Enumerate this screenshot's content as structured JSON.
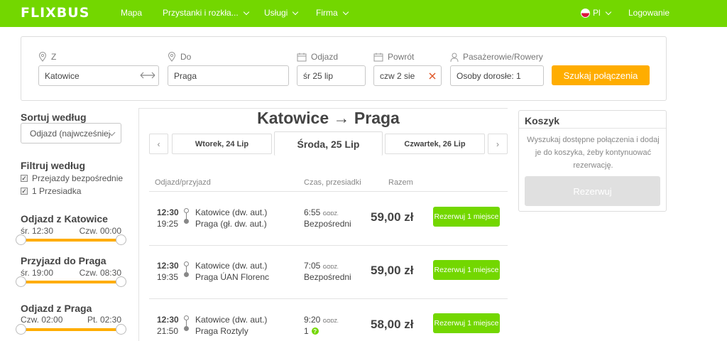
{
  "header": {
    "logo": "FLIXBUS",
    "nav": [
      "Mapa",
      "Przystanki i rozkła...",
      "Usługi",
      "Firma"
    ],
    "lang": "Pl",
    "login": "Logowanie",
    "accent": "#73d700"
  },
  "search": {
    "from_label": "Z",
    "from_value": "Katowice",
    "to_label": "Do",
    "to_value": "Praga",
    "depart_label": "Odjazd",
    "depart_value": "śr 25 lip",
    "return_label": "Powrót",
    "return_value": "czw 2 sie",
    "pax_label": "Pasażerowie/Rowery",
    "pax_value": "Osoby dorosłe: 1",
    "submit": "Szukaj połączenia",
    "submit_color": "#ffad00"
  },
  "sidebar": {
    "sort_title": "Sortuj według",
    "sort_value": "Odjazd (najwcześniej",
    "filter_title": "Filtruj według",
    "filters": [
      {
        "label": "Przejazdy bezpośrednie",
        "checked": true
      },
      {
        "label": "1 Przesiadka",
        "checked": true
      }
    ],
    "ranges": [
      {
        "title": "Odjazd z Katowice",
        "from": "śr. 12:30",
        "to": "Czw. 00:00"
      },
      {
        "title": "Przyjazd do Praga",
        "from": "śr. 19:00",
        "to": "Czw. 08:30"
      },
      {
        "title": "Odjazd z Praga",
        "from": "Czw. 02:00",
        "to": "Pt. 02:30"
      }
    ]
  },
  "main": {
    "title": "Katowice → Praga",
    "prev_arrow": "‹",
    "next_arrow": "›",
    "dates": [
      {
        "label": "Wtorek, 24 Lip",
        "active": false
      },
      {
        "label": "Środa, 25 Lip",
        "active": true
      },
      {
        "label": "Czwartek, 26 Lip",
        "active": false
      }
    ],
    "columns": [
      "Odjazd/przyjazd",
      "Czas, przesiadki",
      "Razem"
    ],
    "rides": [
      {
        "dep": "12:30",
        "arr": "19:25",
        "from": "Katowice (dw. aut.)",
        "to": "Praga (gł. dw. aut.)",
        "duration": "6:55",
        "unit": "GODZ.",
        "transfers": "Bezpośredni",
        "price": "59,00 zł",
        "book": "Rezerwuj 1 miejsce"
      },
      {
        "dep": "12:30",
        "arr": "19:35",
        "from": "Katowice (dw. aut.)",
        "to": "Praga ÚAN Florenc",
        "duration": "7:05",
        "unit": "GODZ.",
        "transfers": "Bezpośredni",
        "price": "59,00 zł",
        "book": "Rezerwuj 1 miejsce"
      },
      {
        "dep": "12:30",
        "arr": "21:50",
        "from": "Katowice (dw. aut.)",
        "to": "Praga Roztyly",
        "duration": "9:20",
        "unit": "GODZ.",
        "transfers": "1",
        "price": "58,00 zł",
        "book": "Rezerwuj 1 miejsce"
      }
    ]
  },
  "basket": {
    "title": "Koszyk",
    "text": "Wyszukaj dostępne połączenia i dodaj je do koszyka, żeby kontynuować rezerwację.",
    "button": "Rezerwuj"
  }
}
